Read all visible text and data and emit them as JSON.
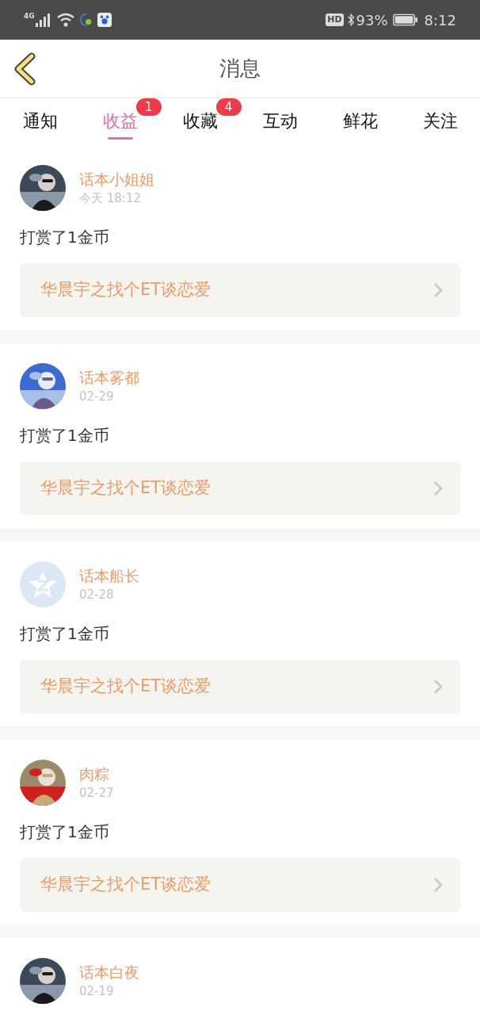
{
  "status_bar": {
    "network": "4G",
    "hd": "HD",
    "battery": "93%",
    "time": "8:12"
  },
  "header": {
    "title": "消息"
  },
  "tabs": [
    {
      "label": "通知",
      "selected": false
    },
    {
      "label": "收益",
      "selected": true,
      "badge": "1"
    },
    {
      "label": "收藏",
      "selected": false,
      "badge": "4"
    },
    {
      "label": "互动",
      "selected": false
    },
    {
      "label": "鲜花",
      "selected": false
    },
    {
      "label": "关注",
      "selected": false
    }
  ],
  "messages": [
    {
      "name": "话本小姐姐",
      "time": "今天 18:12",
      "text": "打赏了1金币",
      "link": "华晨宇之找个ET谈恋爱"
    },
    {
      "name": "话本雾都",
      "time": "02-29",
      "text": "打赏了1金币",
      "link": "华晨宇之找个ET谈恋爱"
    },
    {
      "avatar": {
        "kind": "default"
      },
      "name": "话本船长",
      "time": "02-28",
      "text": "打赏了1金币",
      "link": "华晨宇之找个ET谈恋爱"
    },
    {
      "name": "肉粽",
      "time": "02-27",
      "text": "打赏了1金币",
      "link": "华晨宇之找个ET谈恋爱"
    },
    {
      "name": "话本白夜",
      "time": "02-19"
    }
  ]
}
